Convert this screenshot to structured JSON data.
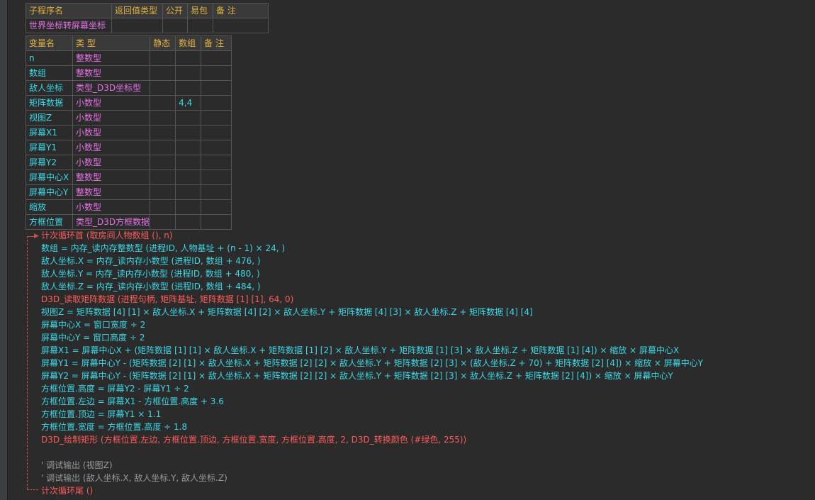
{
  "subroutine_table": {
    "headers": [
      "子程序名",
      "返回值类型",
      "公开",
      "易包",
      "备 注"
    ],
    "row": [
      "世界坐标转屏幕坐标",
      "",
      "",
      "",
      ""
    ]
  },
  "var_table": {
    "headers": [
      "变量名",
      "类 型",
      "静态",
      "数组",
      "备 注"
    ],
    "rows": [
      [
        "n",
        "整数型",
        "",
        "",
        ""
      ],
      [
        "数组",
        "整数型",
        "",
        "",
        ""
      ],
      [
        "敌人坐标",
        "类型_D3D坐标型",
        "",
        "",
        ""
      ],
      [
        "矩阵数据",
        "小数型",
        "",
        "4,4",
        ""
      ],
      [
        "视图Z",
        "小数型",
        "",
        "",
        ""
      ],
      [
        "屏幕X1",
        "小数型",
        "",
        "",
        ""
      ],
      [
        "屏幕Y1",
        "小数型",
        "",
        "",
        ""
      ],
      [
        "屏幕Y2",
        "小数型",
        "",
        "",
        ""
      ],
      [
        "屏幕中心X",
        "整数型",
        "",
        "",
        ""
      ],
      [
        "屏幕中心Y",
        "整数型",
        "",
        "",
        ""
      ],
      [
        "缩放",
        "小数型",
        "",
        "",
        ""
      ],
      [
        "方框位置",
        "类型_D3D方框数据",
        "",
        "",
        ""
      ]
    ]
  },
  "code_lines": [
    "计次循环首 (取房间人物数组 (), n)",
    "数组 = 内存_读内存整数型 (进程ID, 人物基址 + (n - 1) × 24, )",
    "敌人坐标.X = 内存_读内存小数型 (进程ID, 数组 + 476, )",
    "敌人坐标.Y = 内存_读内存小数型 (进程ID, 数组 + 480, )",
    "敌人坐标.Z = 内存_读内存小数型 (进程ID, 数组 + 484, )",
    "D3D_读取矩阵数据 (进程句柄, 矩阵基址, 矩阵数据 [1] [1], 64, 0)",
    "视图Z = 矩阵数据 [4] [1] × 敌人坐标.X + 矩阵数据 [4] [2] × 敌人坐标.Y + 矩阵数据 [4] [3] × 敌人坐标.Z + 矩阵数据 [4] [4]",
    "屏幕中心X = 窗口宽度 ÷ 2",
    "屏幕中心Y = 窗口高度 ÷ 2",
    "屏幕X1 = 屏幕中心X + (矩阵数据 [1] [1] × 敌人坐标.X + 矩阵数据 [1] [2] × 敌人坐标.Y + 矩阵数据 [1] [3] × 敌人坐标.Z + 矩阵数据 [1] [4]) × 缩放 × 屏幕中心X",
    "屏幕Y1 = 屏幕中心Y - (矩阵数据 [2] [1] × 敌人坐标.X + 矩阵数据 [2] [2] × 敌人坐标.Y + 矩阵数据 [2] [3] × (敌人坐标.Z + 70) + 矩阵数据 [2] [4]) × 缩放 × 屏幕中心Y",
    "屏幕Y2 = 屏幕中心Y - (矩阵数据 [2] [1] × 敌人坐标.X + 矩阵数据 [2] [2] × 敌人坐标.Y + 矩阵数据 [2] [3] × 敌人坐标.Z + 矩阵数据 [2] [4]) × 缩放 × 屏幕中心Y",
    "方框位置.高度 = 屏幕Y2 - 屏幕Y1 ÷ 2",
    "方框位置.左边 = 屏幕X1 - 方框位置.高度 + 3.6",
    "方框位置.顶边 = 屏幕Y1 × 1.1",
    "方框位置.宽度 = 方框位置.高度 ÷ 1.8",
    "D3D_绘制矩形 (方框位置.左边, 方框位置.顶边, 方框位置.宽度, 方框位置.高度, 2, D3D_转换颜色 (#绿色, 255))",
    "",
    "' 调试输出 (视图Z)",
    "' 调试输出 (敌人坐标.X, 敌人坐标.Y, 敌人坐标.Z)",
    "计次循环尾 ()"
  ]
}
